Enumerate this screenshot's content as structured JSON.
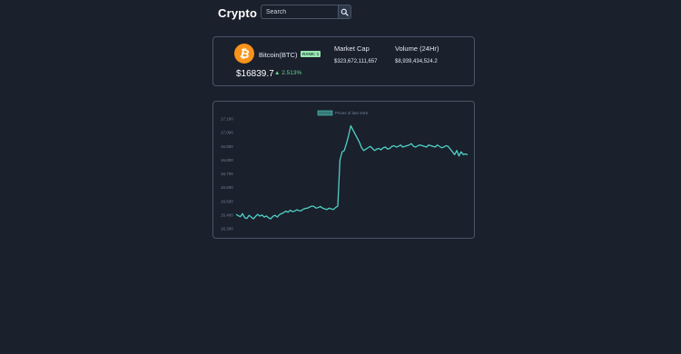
{
  "header": {
    "title": "Crypto"
  },
  "search": {
    "placeholder": "Search",
    "value": ""
  },
  "coin": {
    "name": "Bitcoin(BTC)",
    "rank": "RANK: 1",
    "price": "$16839.7",
    "change": "2.513%",
    "change_direction": "up",
    "icon": "bitcoin-icon",
    "icon_color": "#f7931a"
  },
  "stats": {
    "market_cap_label": "Market Cap",
    "market_cap_value": "$323,672,111,657",
    "volume_label": "Volume (24Hr)",
    "volume_value": "$8,939,434,524.2"
  },
  "colors": {
    "accent": "#4fd1c5",
    "positive": "#68d391",
    "background": "#1a202c",
    "border": "#4a5568"
  },
  "chart_data": {
    "type": "line",
    "title": "",
    "xlabel": "",
    "ylabel": "",
    "legend": "Prices of last 24Hr",
    "legend_position": "top-center",
    "ylim": [
      16300,
      17100
    ],
    "yticks": [
      16300,
      16400,
      16500,
      16600,
      16700,
      16800,
      16900,
      17000,
      17100
    ],
    "ytick_labels": [
      "16,300",
      "16,400",
      "16,500",
      "16,600",
      "16,700",
      "16,800",
      "16,900",
      "17,000",
      "17,100"
    ],
    "grid": false,
    "series": [
      {
        "name": "Prices of last 24Hr",
        "color": "#4fd1c5",
        "values": [
          16405,
          16395,
          16388,
          16410,
          16380,
          16375,
          16398,
          16385,
          16372,
          16390,
          16405,
          16392,
          16400,
          16385,
          16393,
          16380,
          16372,
          16390,
          16398,
          16385,
          16402,
          16410,
          16418,
          16428,
          16420,
          16435,
          16425,
          16428,
          16438,
          16432,
          16430,
          16442,
          16448,
          16450,
          16458,
          16465,
          16462,
          16450,
          16455,
          16462,
          16450,
          16445,
          16440,
          16450,
          16445,
          16440,
          16455,
          16465,
          16800,
          16860,
          16870,
          16920,
          16980,
          17050,
          17020,
          16990,
          16960,
          16930,
          16890,
          16870,
          16880,
          16890,
          16900,
          16885,
          16870,
          16880,
          16885,
          16875,
          16890,
          16895,
          16880,
          16885,
          16900,
          16905,
          16895,
          16900,
          16910,
          16895,
          16900,
          16905,
          16910,
          16920,
          16900,
          16895,
          16905,
          16910,
          16905,
          16900,
          16895,
          16910,
          16905,
          16900,
          16895,
          16910,
          16900,
          16890,
          16895,
          16905,
          16900,
          16880,
          16860,
          16840,
          16870,
          16830,
          16860,
          16840,
          16845,
          16839
        ]
      }
    ]
  }
}
